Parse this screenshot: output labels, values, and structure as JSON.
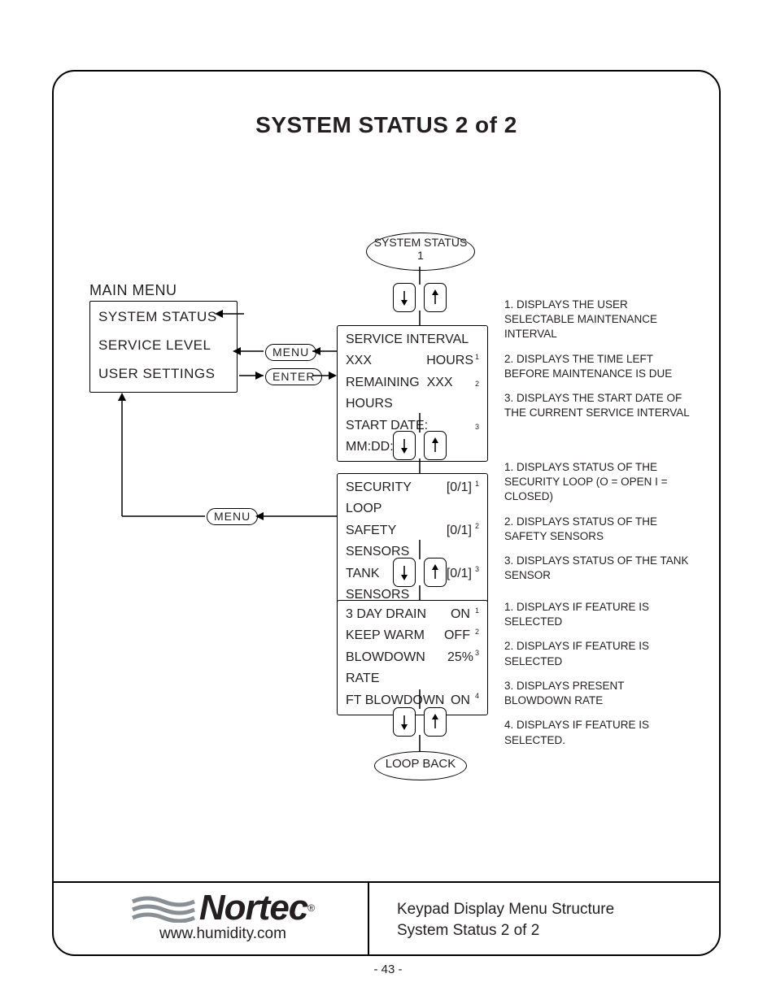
{
  "title": "SYSTEM STATUS 2 of 2",
  "main_menu": {
    "heading": "MAIN MENU",
    "items": [
      "SYSTEM STATUS",
      "SERVICE LEVEL",
      "USER SETTINGS"
    ]
  },
  "buttons": {
    "menu": "MENU",
    "enter": "ENTER"
  },
  "nodes": {
    "top_ellipse_line1": "SYSTEM STATUS",
    "top_ellipse_line2": "1",
    "loop_back": "LOOP BACK"
  },
  "screens": {
    "service_interval": {
      "title": "SERVICE INTERVAL",
      "row1_left": "XXX",
      "row1_right": "HOURS",
      "row1_sup": "1",
      "row2_left": "REMAINING",
      "row2_right": "XXX HOURS",
      "row2_sup": "2",
      "row3_left": "START DATE: MM:DD:YY",
      "row3_sup": "3"
    },
    "sensors": {
      "row1_left": "SECURITY LOOP",
      "row1_right": "[0/1]",
      "row1_sup": "1",
      "row2_left": "SAFETY SENSORS",
      "row2_right": "[0/1]",
      "row2_sup": "2",
      "row3_left": "TANK SENSORS",
      "row3_right": "[0/1]",
      "row3_sup": "3"
    },
    "features": {
      "row1_left": "3 DAY DRAIN",
      "row1_right": "ON",
      "row1_sup": "1",
      "row2_left": "KEEP WARM",
      "row2_right": "OFF",
      "row2_sup": "2",
      "row3_left": "BLOWDOWN RATE",
      "row3_right": "25%",
      "row3_sup": "3",
      "row4_left": "FT BLOWDOWN",
      "row4_right": "ON",
      "row4_sup": "4"
    }
  },
  "notes": {
    "group1": [
      "1. DISPLAYS THE USER SELECTABLE  MAINTENANCE INTERVAL",
      "2. DISPLAYS THE TIME LEFT BEFORE MAINTENANCE IS DUE",
      "3. DISPLAYS THE START DATE OF THE CURRENT SERVICE INTERVAL"
    ],
    "group2": [
      "1. DISPLAYS STATUS OF THE SECURITY LOOP (O = OPEN   I = CLOSED)",
      "2. DISPLAYS STATUS OF THE SAFETY SENSORS",
      "3. DISPLAYS STATUS OF THE TANK SENSOR"
    ],
    "group3": [
      "1. DISPLAYS IF FEATURE IS SELECTED",
      "2. DISPLAYS IF FEATURE IS SELECTED",
      "3. DISPLAYS PRESENT BLOWDOWN RATE",
      "4. DISPLAYS IF FEATURE IS SELECTED."
    ]
  },
  "footer": {
    "line1": "Keypad Display Menu Structure",
    "line2": "System Status 2 of 2",
    "logo_name": "Nortec",
    "logo_url": "www.humidity.com"
  },
  "page_number": "- 43 -"
}
